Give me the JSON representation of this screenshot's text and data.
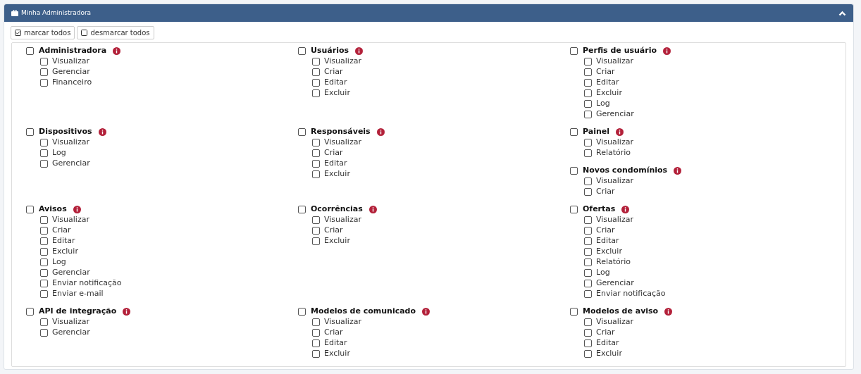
{
  "panel": {
    "title": "Minha Administradora",
    "expanded": true
  },
  "toolbar": [
    {
      "label": "marcar todos",
      "kind": "check"
    },
    {
      "label": "desmarcar todos",
      "kind": "uncheck"
    }
  ],
  "rows": [
    {
      "cells": [
        [
          {
            "label": "Administradora",
            "checked": false,
            "items": [
              {
                "label": "Visualizar",
                "checked": false
              },
              {
                "label": "Gerenciar",
                "checked": false
              },
              {
                "label": "Financeiro",
                "checked": false
              }
            ]
          }
        ],
        [
          {
            "label": "Usuários",
            "checked": false,
            "items": [
              {
                "label": "Visualizar",
                "checked": false
              },
              {
                "label": "Criar",
                "checked": false
              },
              {
                "label": "Editar",
                "checked": false
              },
              {
                "label": "Excluir",
                "checked": false
              }
            ]
          }
        ],
        [
          {
            "label": "Perfis de usuário",
            "checked": false,
            "items": [
              {
                "label": "Visualizar",
                "checked": false
              },
              {
                "label": "Criar",
                "checked": false
              },
              {
                "label": "Editar",
                "checked": false
              },
              {
                "label": "Excluir",
                "checked": false
              },
              {
                "label": "Log",
                "checked": false
              },
              {
                "label": "Gerenciar",
                "checked": false
              }
            ]
          }
        ]
      ]
    },
    {
      "cells": [
        [
          {
            "label": "Dispositivos",
            "checked": false,
            "items": [
              {
                "label": "Visualizar",
                "checked": false
              },
              {
                "label": "Log",
                "checked": false
              },
              {
                "label": "Gerenciar",
                "checked": false
              }
            ]
          }
        ],
        [
          {
            "label": "Responsáveis",
            "checked": false,
            "items": [
              {
                "label": "Visualizar",
                "checked": false
              },
              {
                "label": "Criar",
                "checked": false
              },
              {
                "label": "Editar",
                "checked": false
              },
              {
                "label": "Excluir",
                "checked": false
              }
            ]
          }
        ],
        [
          {
            "label": "Painel",
            "checked": false,
            "items": [
              {
                "label": "Visualizar",
                "checked": false
              },
              {
                "label": "Relatório",
                "checked": false
              }
            ]
          },
          {
            "label": "Novos condomínios",
            "checked": false,
            "items": [
              {
                "label": "Visualizar",
                "checked": false
              },
              {
                "label": "Criar",
                "checked": false
              }
            ]
          }
        ]
      ]
    },
    {
      "cells": [
        [
          {
            "label": "Avisos",
            "checked": false,
            "items": [
              {
                "label": "Visualizar",
                "checked": false
              },
              {
                "label": "Criar",
                "checked": false
              },
              {
                "label": "Editar",
                "checked": false
              },
              {
                "label": "Excluir",
                "checked": false
              },
              {
                "label": "Log",
                "checked": false
              },
              {
                "label": "Gerenciar",
                "checked": false
              },
              {
                "label": "Enviar notificação",
                "checked": false
              },
              {
                "label": "Enviar e-mail",
                "checked": false
              }
            ]
          }
        ],
        [
          {
            "label": "Ocorrências",
            "checked": false,
            "items": [
              {
                "label": "Visualizar",
                "checked": false
              },
              {
                "label": "Criar",
                "checked": false
              },
              {
                "label": "Excluir",
                "checked": false
              }
            ]
          }
        ],
        [
          {
            "label": "Ofertas",
            "checked": false,
            "items": [
              {
                "label": "Visualizar",
                "checked": false
              },
              {
                "label": "Criar",
                "checked": false
              },
              {
                "label": "Editar",
                "checked": false
              },
              {
                "label": "Excluir",
                "checked": false
              },
              {
                "label": "Relatório",
                "checked": false
              },
              {
                "label": "Log",
                "checked": false
              },
              {
                "label": "Gerenciar",
                "checked": false
              },
              {
                "label": "Enviar notificação",
                "checked": false
              }
            ]
          }
        ]
      ]
    },
    {
      "cells": [
        [
          {
            "label": "API de integração",
            "checked": false,
            "items": [
              {
                "label": "Visualizar",
                "checked": false
              },
              {
                "label": "Gerenciar",
                "checked": false
              }
            ]
          }
        ],
        [
          {
            "label": "Modelos de comunicado",
            "checked": false,
            "items": [
              {
                "label": "Visualizar",
                "checked": false
              },
              {
                "label": "Criar",
                "checked": false
              },
              {
                "label": "Editar",
                "checked": false
              },
              {
                "label": "Excluir",
                "checked": false
              }
            ]
          }
        ],
        [
          {
            "label": "Modelos de aviso",
            "checked": false,
            "items": [
              {
                "label": "Visualizar",
                "checked": false
              },
              {
                "label": "Criar",
                "checked": false
              },
              {
                "label": "Editar",
                "checked": false
              },
              {
                "label": "Excluir",
                "checked": false
              }
            ]
          }
        ]
      ]
    }
  ]
}
